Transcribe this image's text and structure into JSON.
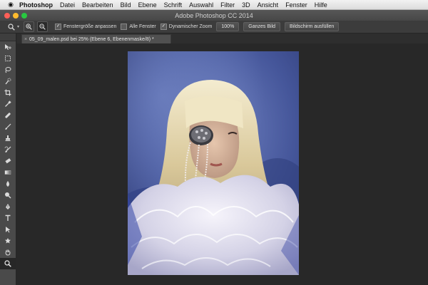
{
  "menubar": {
    "apple_icon": "apple-icon",
    "items": [
      "Photoshop",
      "Datei",
      "Bearbeiten",
      "Bild",
      "Ebene",
      "Schrift",
      "Auswahl",
      "Filter",
      "3D",
      "Ansicht",
      "Fenster",
      "Hilfe"
    ]
  },
  "window": {
    "title": "Adobe Photoshop CC 2014",
    "traffic_lights": [
      "#fd5f57",
      "#febc2e",
      "#28c840"
    ]
  },
  "options_bar": {
    "tool_icon": "zoom-tool-icon",
    "zoom_in_icon": "zoom-in-icon",
    "zoom_out_icon": "zoom-out-icon",
    "checkboxes": [
      {
        "label": "Fenstergröße anpassen",
        "checked": true
      },
      {
        "label": "Alle Fenster",
        "checked": false
      },
      {
        "label": "Dynamischer Zoom",
        "checked": true
      }
    ],
    "buttons": [
      "100%",
      "Ganzes Bild",
      "Bildschirm ausfüllen"
    ]
  },
  "document_tab": {
    "title": "05_09_malen.psd bei 25% (Ebene 6, Ebenenmaske/8) *",
    "close_symbol": "×"
  },
  "toolbar": {
    "tools": [
      "move-tool-icon",
      "marquee-tool-icon",
      "lasso-tool-icon",
      "quick-select-tool-icon",
      "crop-tool-icon",
      "eyedropper-tool-icon",
      "healing-brush-icon",
      "brush-tool-icon",
      "clone-stamp-icon",
      "history-brush-icon",
      "eraser-tool-icon",
      "gradient-tool-icon",
      "blur-tool-icon",
      "dodge-tool-icon",
      "pen-tool-icon",
      "type-tool-icon",
      "path-select-icon",
      "custom-shape-icon",
      "hand-tool-icon",
      "zoom-tool-icon"
    ],
    "selected_tool": "zoom-tool-icon"
  },
  "colors": {
    "interface_dark": "#282828",
    "panel": "#4a4a4a",
    "artwork_blue": "#3d4f8f",
    "hair": "#e9dfbe"
  }
}
